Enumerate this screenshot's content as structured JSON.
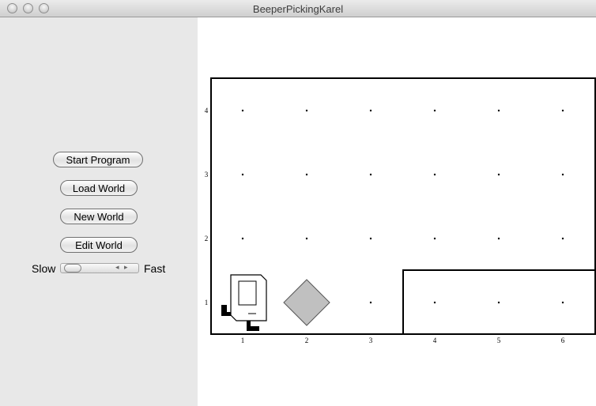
{
  "window": {
    "title": "BeeperPickingKarel"
  },
  "controls": {
    "start_program": "Start Program",
    "load_world": "Load World",
    "new_world": "New World",
    "edit_world": "Edit World",
    "speed_slow": "Slow",
    "speed_fast": "Fast"
  },
  "world": {
    "columns": 6,
    "rows": 4,
    "column_labels": [
      "1",
      "2",
      "3",
      "4",
      "5",
      "6"
    ],
    "row_labels": [
      "1",
      "2",
      "3",
      "4"
    ],
    "karel": {
      "avenue": 1,
      "street": 1,
      "facing": "east"
    },
    "beepers": [
      {
        "avenue": 2,
        "street": 1
      }
    ],
    "walls_note": "inner wall around avenues 4-6 of street 1"
  }
}
